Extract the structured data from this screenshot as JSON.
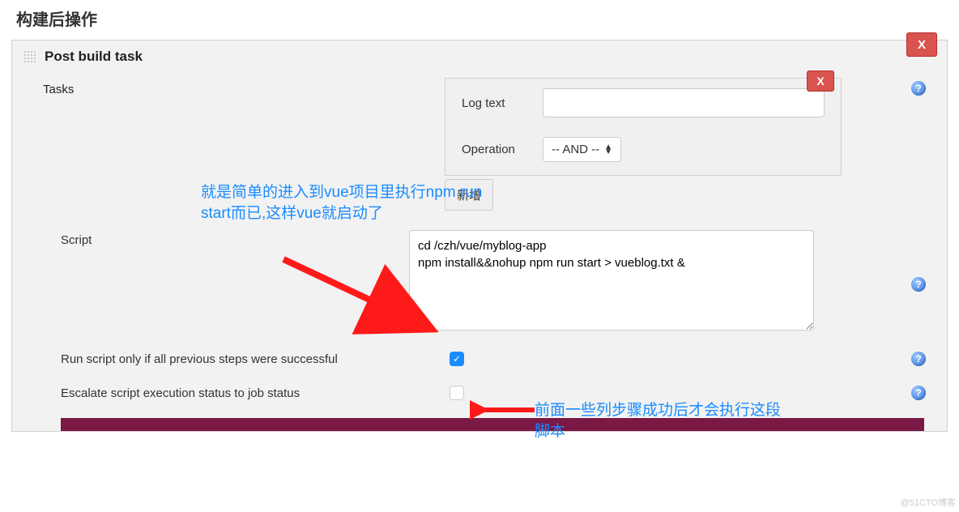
{
  "page_title": "构建后操作",
  "section": {
    "title": "Post build task",
    "close_label": "X"
  },
  "tasks": {
    "label": "Tasks",
    "log_text_label": "Log text",
    "log_text_value": "",
    "operation_label": "Operation",
    "operation_selected": "-- AND --",
    "close_label": "X",
    "add_button": "新增"
  },
  "script": {
    "label": "Script",
    "value": "cd /czh/vue/myblog-app\nnpm install&&nohup npm run start > vueblog.txt &"
  },
  "checkbox1": {
    "label": "Run script only if all previous steps were successful",
    "checked": true
  },
  "checkbox2": {
    "label": "Escalate script execution status to job status",
    "checked": false
  },
  "annotations": {
    "anno1": "就是简单的进入到vue项目里执行npm run start而已,这样vue就启动了",
    "anno2": "前面一些列步骤成功后才会执行这段脚本"
  },
  "help_glyph": "?",
  "watermark": "@51CTO博客"
}
